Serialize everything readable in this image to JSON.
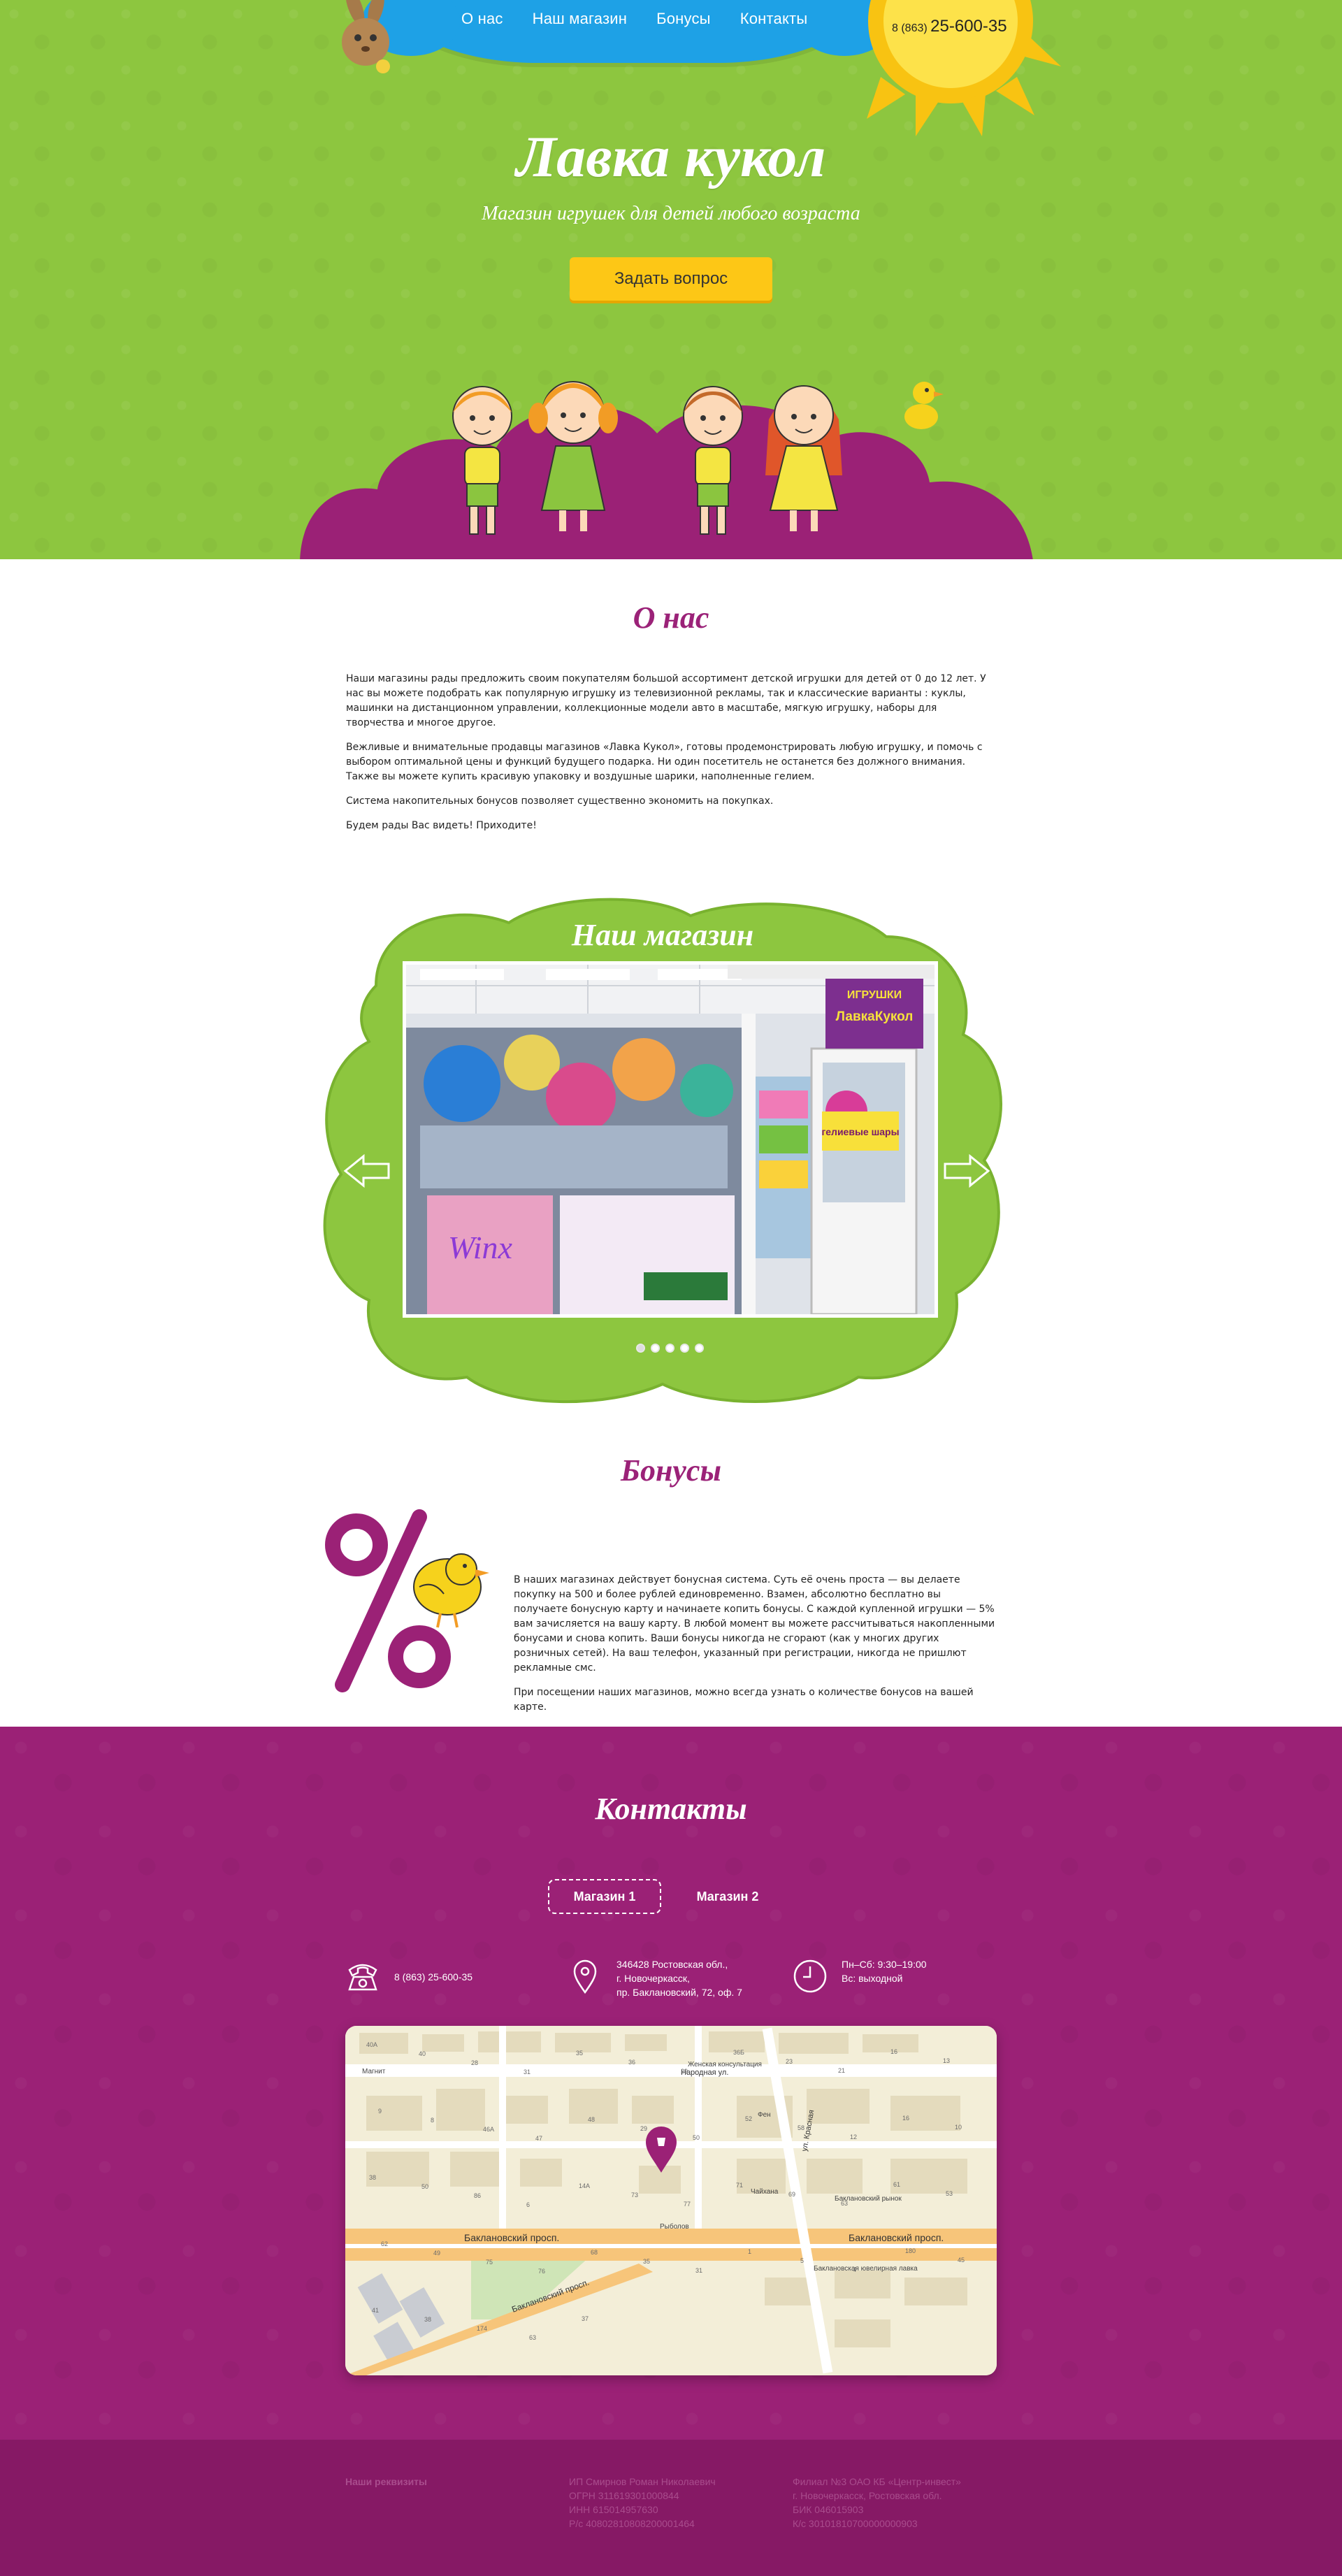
{
  "nav": {
    "items": [
      {
        "label": "О нас"
      },
      {
        "label": "Наш магазин"
      },
      {
        "label": "Бонусы"
      },
      {
        "label": "Контакты"
      }
    ],
    "phone_prefix": "8 (863)",
    "phone_number": "25-600-35"
  },
  "hero": {
    "title": "Лавка кукол",
    "subtitle": "Магазин игрушек для детей любого возраста",
    "button": "Задать вопрос"
  },
  "about": {
    "title": "О нас",
    "paragraphs": [
      "Наши магазины рады предложить своим покупателям большой ассортимент детской игрушки для детей от 0 до 12 лет. У нас вы можете подобрать как популярную игрушку из телевизионной рекламы, так и классические варианты : куклы, машинки на дистанционном управлении, коллекционные модели авто в масштабе, мягкую игрушку, наборы для творчества и многое другое.",
      "Вежливые и внимательные продавцы магазинов «Лавка Кукол», готовы продемонстрировать любую игрушку, и помочь с выбором оптимальной цены и функций будущего подарка. Ни один посетитель не останется без должного внимания. Также вы можете купить красивую упаковку и воздушные шарики, наполненные гелием.",
      "Система накопительных бонусов позволяет существенно экономить на покупках.",
      "Будем рады Вас видеть! Приходите!"
    ]
  },
  "shop": {
    "title": "Наш магазин",
    "photo_sign_top": "ИГРУШКИ",
    "photo_sign_brand": "ЛавкаКукол",
    "photo_balloon_sign": "гелиевые шары",
    "slides_count": 5,
    "active_slide": 1
  },
  "bonus": {
    "title": "Бонусы",
    "paragraphs": [
      "В наших магазинах действует бонусная система. Суть её очень проста — вы делаете покупку на 500 и более рублей единовременно. Взамен, абсолютно бесплатно вы получаете бонусную карту и начинаете копить бонусы. С каждой купленной игрушки — 5% вам зачисляется на вашу карту. В любой момент вы можете рассчитываться накопленными бонусами и снова копить. Ваши бонусы никогда не сгорают (как у многих других розничных сетей). На ваш телефон, указанный при регистрации, никогда не пришлют рекламные смс.",
      "При посещении наших магазинов, можно всегда узнать о количестве бонусов на вашей карте."
    ]
  },
  "contacts": {
    "title": "Контакты",
    "tabs": [
      {
        "label": "Магазин 1"
      },
      {
        "label": "Магазин 2"
      }
    ],
    "phone": "8 (863) 25-600-35",
    "address": [
      "346428 Ростовская обл.,",
      "г. Новочеркасск,",
      "пр. Баклановский, 72, оф. 7"
    ],
    "hours": [
      "Пн–Сб: 9:30–19:00",
      "Вс: выходной"
    ],
    "map": {
      "street_main": "Баклановский просп.",
      "street_main_right": "Баклановский просп.",
      "street_diag": "Баклановский просп.",
      "street_north": "Народная ул.",
      "street_vert": "ул. Красная",
      "label_clinic": "Женская консультация",
      "label_market": "Магнит",
      "label_rybolov": "Рыболов",
      "label_chaynaya": "Чайхана",
      "label_fen": "Фен",
      "label_bakl_market": "Баклановский рынок",
      "label_bakl_lavka": "Баклановская ювелирная лавка",
      "numbers": [
        "40А",
        "40",
        "28",
        "31",
        "35",
        "36",
        "29",
        "36Б",
        "23",
        "21",
        "16",
        "13",
        "9",
        "8",
        "46А",
        "47",
        "48",
        "29",
        "50",
        "52",
        "58",
        "12",
        "16",
        "10",
        "38",
        "50",
        "86",
        "6",
        "14А",
        "73",
        "77",
        "71",
        "69",
        "63",
        "61",
        "53",
        "62",
        "49",
        "75",
        "76",
        "68",
        "35",
        "31",
        "1",
        "5",
        "4",
        "180",
        "45",
        "41",
        "38",
        "174",
        "63",
        "37"
      ]
    }
  },
  "footer": {
    "col1": {
      "head": "Наши реквизиты"
    },
    "col2": [
      "ИП Смирнов Роман Николаевич",
      "ОГРН 311619301000844",
      "ИНН 615014957630",
      "Р/с 40802810808200001464"
    ],
    "col3": [
      "Филиал №3 ОАО КБ «Центр-инвест»",
      "г. Новочеркасск, Ростовская обл.",
      "БИК 046015903",
      "К/с 30101810700000000903"
    ]
  },
  "colors": {
    "green": "#8dc63f",
    "blue": "#1ea1e6",
    "purple": "#9b2176",
    "yellow": "#fdc716",
    "title_purple": "#9b2278"
  },
  "icons": [
    "bunny-icon",
    "sun-icon",
    "kids-illustration",
    "duck-icon",
    "arrow-left-icon",
    "arrow-right-icon",
    "percent-icon",
    "chick-icon",
    "phone-icon",
    "location-pin-icon",
    "clock-icon",
    "map-pin-icon"
  ]
}
